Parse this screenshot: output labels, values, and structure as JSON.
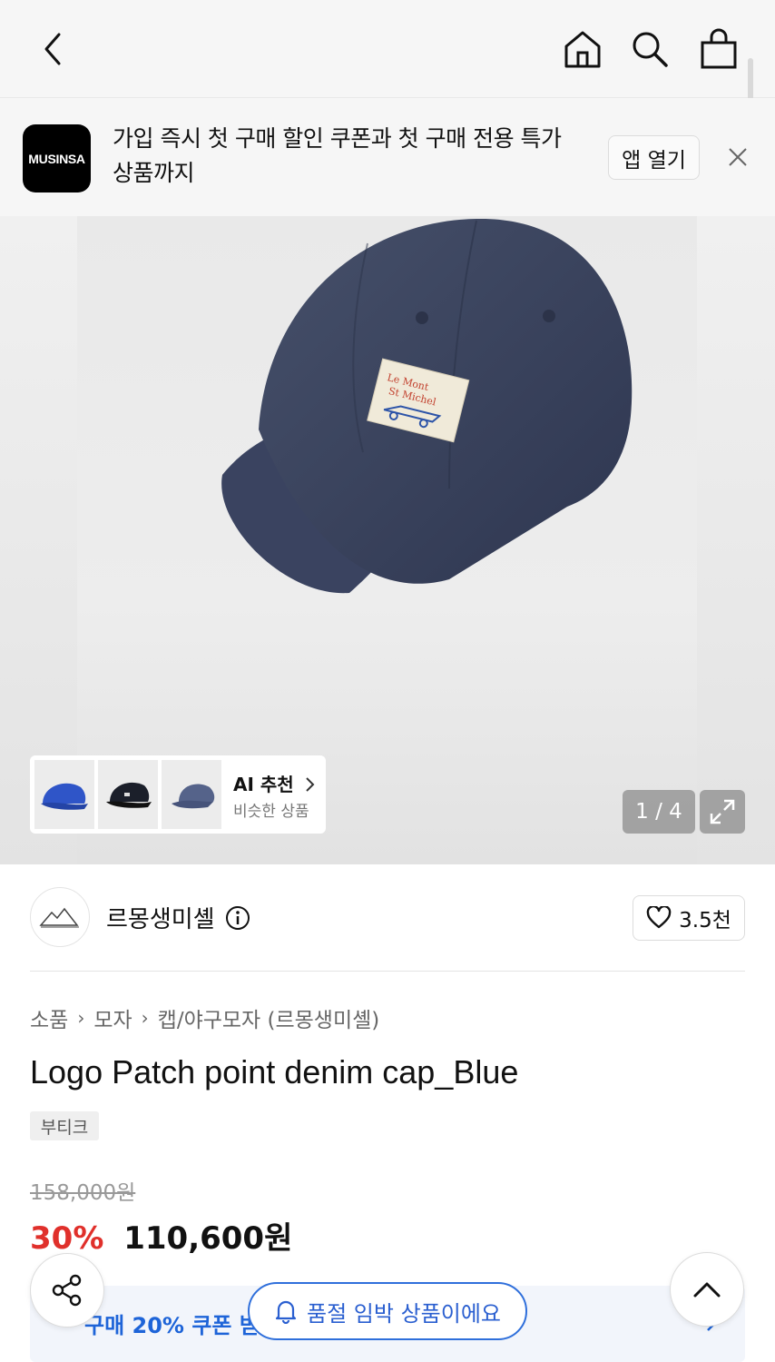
{
  "colors": {
    "accent": "#1e64d8",
    "discount": "#e0302b",
    "topbar_bg": "#f6f6f6"
  },
  "banner": {
    "logo_text": "MUSINSA",
    "message": "가입 즉시 첫 구매 할인 쿠폰과 첫 구매 전용 특가 상품까지",
    "open_app_label": "앱 열기"
  },
  "gallery": {
    "ai_title": "AI 추천",
    "ai_subtitle": "비슷한 상품",
    "counter": "1 / 4"
  },
  "brand": {
    "name": "르몽생미셸",
    "likes": "3.5천"
  },
  "breadcrumb": [
    "소품",
    "모자",
    "캡/야구모자 (르몽생미셸)"
  ],
  "product": {
    "title": "Logo Patch point denim cap_Blue",
    "tag": "부티크",
    "original_price": "158,000원",
    "discount": "30%",
    "price": "110,600원"
  },
  "coupon": {
    "text": "구매 20% 쿠폰 받"
  },
  "soldout_notice": "품절 임박 상품이에요"
}
